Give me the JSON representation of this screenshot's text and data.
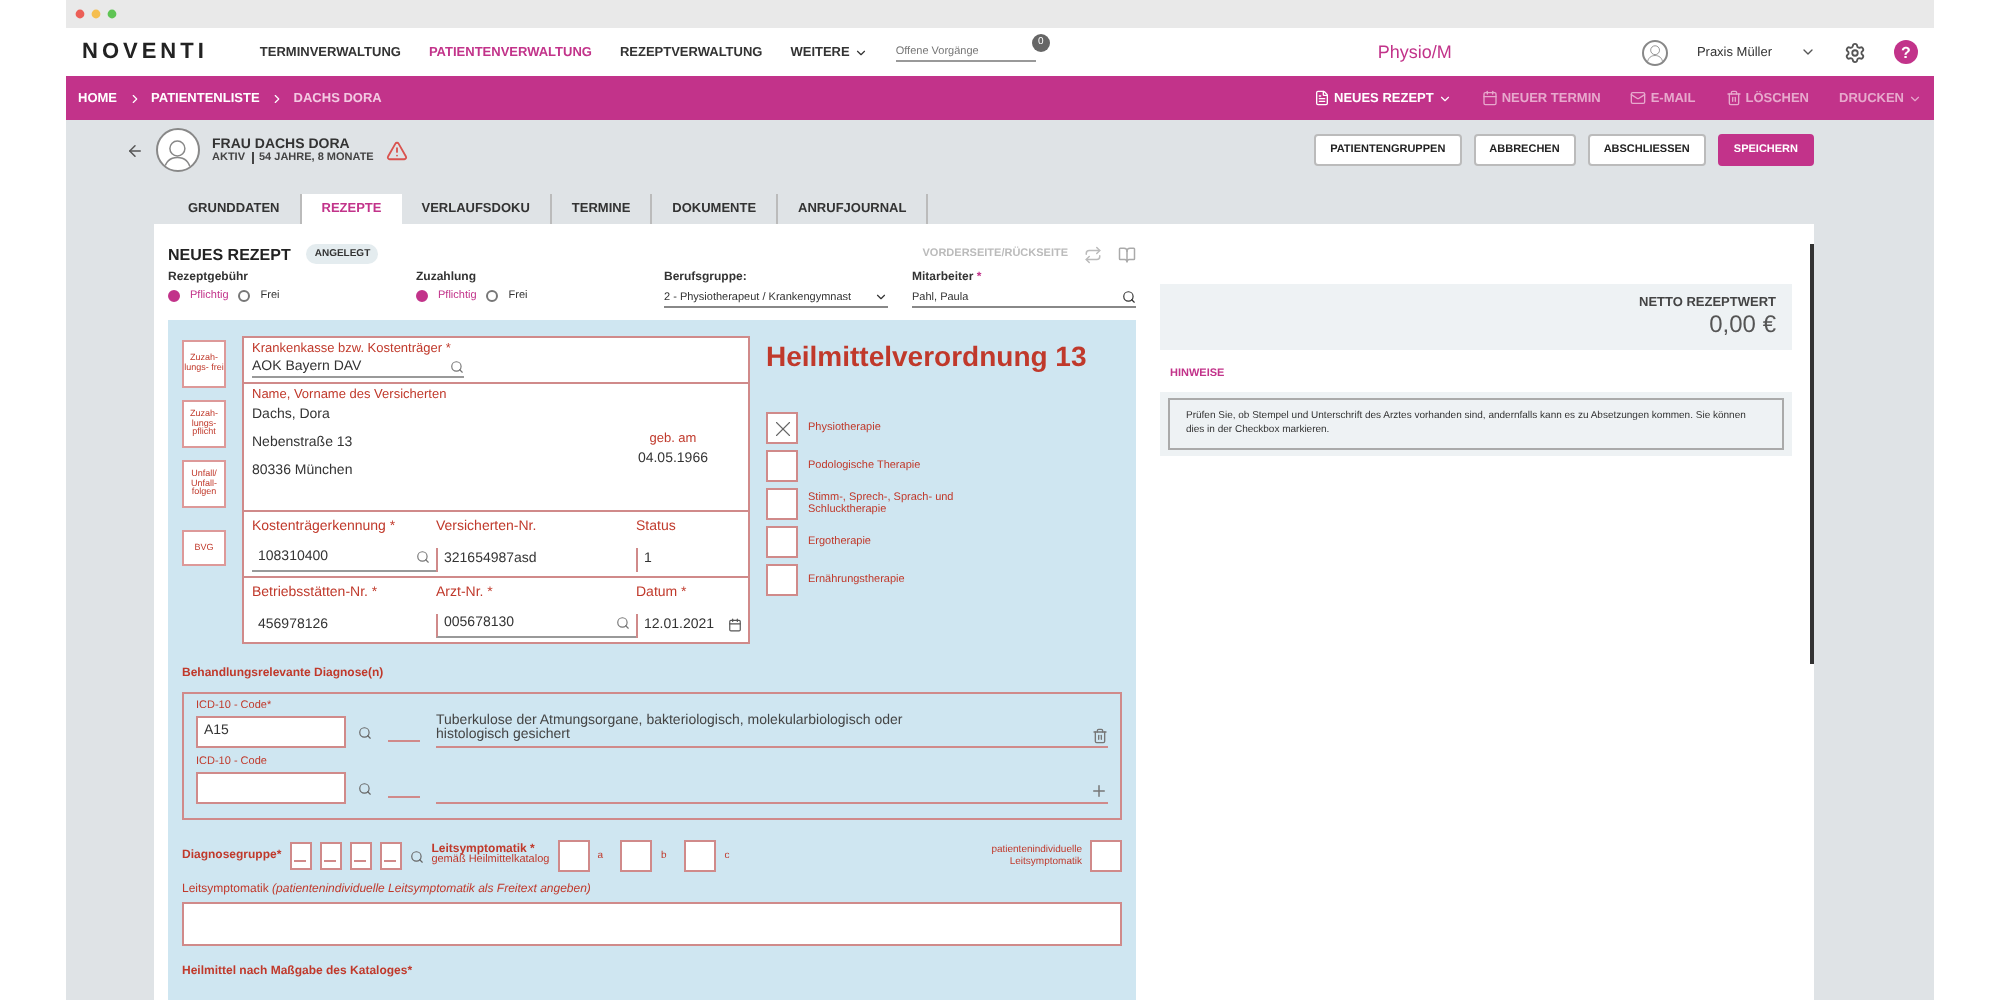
{
  "app": {
    "logo": "NOVENTI",
    "nav": [
      {
        "label": "TERMINVERWALTUNG",
        "selected": false
      },
      {
        "label": "PATIENTENVERWALTUNG",
        "selected": true
      },
      {
        "label": "REZEPTVERWALTUNG",
        "selected": false
      }
    ],
    "more": "WEITERE",
    "search_placeholder": "Offene Vorgänge",
    "badge": "0",
    "center_title": "Physio/M",
    "user": "Praxis Müller",
    "help": "?"
  },
  "breadcrumb": [
    "HOME",
    "PATIENTENLISTE",
    "DACHS DORA"
  ],
  "actions": [
    {
      "label": "NEUES REZEPT",
      "kind": "document",
      "disabled": false,
      "menu": true
    },
    {
      "label": "NEUER TERMIN",
      "kind": "calendar",
      "disabled": true,
      "menu": false
    },
    {
      "label": "E-MAIL",
      "kind": "mail",
      "disabled": true,
      "menu": false
    },
    {
      "label": "LÖSCHEN",
      "kind": "trash",
      "disabled": true,
      "menu": false
    },
    {
      "label": "DRUCKEN",
      "kind": "none",
      "disabled": true,
      "menu": true
    }
  ],
  "patient": {
    "name": "FRAU DACHS DORA",
    "status": "AKTIV",
    "age": "54 JAHRE, 8 MONATE"
  },
  "header_buttons": [
    {
      "label": "PATIENTENGRUPPEN",
      "primary": false
    },
    {
      "label": "ABBRECHEN",
      "primary": false
    },
    {
      "label": "ABSCHLIESSEN",
      "primary": false
    },
    {
      "label": "SPEICHERN",
      "primary": true
    }
  ],
  "tabs": [
    {
      "label": "GRUNDDATEN",
      "selected": false
    },
    {
      "label": "REZEPTE",
      "selected": true
    },
    {
      "label": "VERLAUFSDOKU",
      "selected": false
    },
    {
      "label": "TERMINE",
      "selected": false
    },
    {
      "label": "DOKUMENTE",
      "selected": false
    },
    {
      "label": "ANRUFJOURNAL",
      "selected": false
    }
  ],
  "prescription": {
    "title": "NEUES REZEPT",
    "status": "ANGELEGT",
    "page_toggle": "VORDERSEITE/RÜCKSEITE",
    "fee": {
      "label": "Rezeptgebühr",
      "options": [
        {
          "label": "Pflichtig",
          "selected": true
        },
        {
          "label": "Frei",
          "selected": false
        }
      ]
    },
    "copay": {
      "label": "Zuzahlung",
      "options": [
        {
          "label": "Pflichtig",
          "selected": true
        },
        {
          "label": "Frei",
          "selected": false
        }
      ]
    },
    "profession": {
      "label": "Berufsgruppe:",
      "value": "2 - Physiotherapeut / Krankengymnast"
    },
    "staff": {
      "label": "Mitarbeiter",
      "required": "*",
      "value": "Pahl, Paula"
    }
  },
  "form": {
    "flags": [
      "Zuzah- lungs- frei",
      "Zuzah- lungs- pflicht",
      "Unfall/ Unfall- folgen",
      "BVG"
    ],
    "insurer": {
      "label": "Krankenkasse bzw. Kostenträger *",
      "value": "AOK Bayern DAV"
    },
    "insured": {
      "label": "Name, Vorname des Versicherten",
      "lines": [
        "Dachs, Dora",
        "Nebenstraße 13",
        "80336 München"
      ],
      "birth_label": "geb. am",
      "birth": "04.05.1966"
    },
    "id_rows": [
      [
        {
          "label": "Kostenträgerkennung *",
          "value": "108310400",
          "kind": "search"
        },
        {
          "label": "Versicherten-Nr.",
          "value": "321654987asd",
          "kind": "text"
        },
        {
          "label": "Status",
          "value": "1",
          "kind": "text"
        }
      ],
      [
        {
          "label": "Betriebsstätten-Nr. *",
          "value": "456978126",
          "kind": "text"
        },
        {
          "label": "Arzt-Nr. *",
          "value": "005678130",
          "kind": "search"
        },
        {
          "label": "Datum *",
          "value": "12.01.2021",
          "kind": "date"
        }
      ]
    ],
    "title": "Heilmittelverordnung 13",
    "therapies": [
      {
        "label": "Physiotherapie",
        "checked": true
      },
      {
        "label": "Podologische Therapie",
        "checked": false
      },
      {
        "label": "Stimm-, Sprech-, Sprach- und Schlucktherapie",
        "checked": false
      },
      {
        "label": "Ergotherapie",
        "checked": false
      },
      {
        "label": "Ernährungstherapie",
        "checked": false
      }
    ],
    "diagnoses_label": "Behandlungsrelevante Diagnose(n)",
    "diagnoses": [
      {
        "label": "ICD-10 - Code*",
        "value": "A15",
        "text": "Tuberkulose der Atmungsorgane, bakteriologisch, molekularbiologisch oder histologisch gesichert",
        "kind": "delete"
      },
      {
        "label": "ICD-10 - Code",
        "kind": "add"
      }
    ],
    "diagnosis_group_label": "Diagnosegruppe*",
    "leading_label": "Leitsymptomatik *",
    "leading_sub": "gemäß Heilmittelkatalog",
    "leading_boxes": [
      {
        "label": "a",
        "checked": false
      },
      {
        "label": "b",
        "checked": false
      },
      {
        "label": "c",
        "checked": false
      }
    ],
    "individual": {
      "label": "patientenindividuelle Leitsymptomatik",
      "checked": false
    },
    "freetext_label": "Leitsymptomatik *(patientenindividuelle Leitsymptomatik als Freitext angeben)*",
    "remedies_label": "Heilmittel nach Maßgabe des Kataloges*"
  },
  "summary": {
    "label": "NETTO REZEPTWERT",
    "value": "0,00 €",
    "hint_tab": "HINWEISE",
    "hint": "Prüfen Sie, ob Stempel und Unterschrift des Arztes vorhanden sind, andernfalls kann es zu Absetzungen kommen. Sie können dies in der Checkbox markieren."
  }
}
